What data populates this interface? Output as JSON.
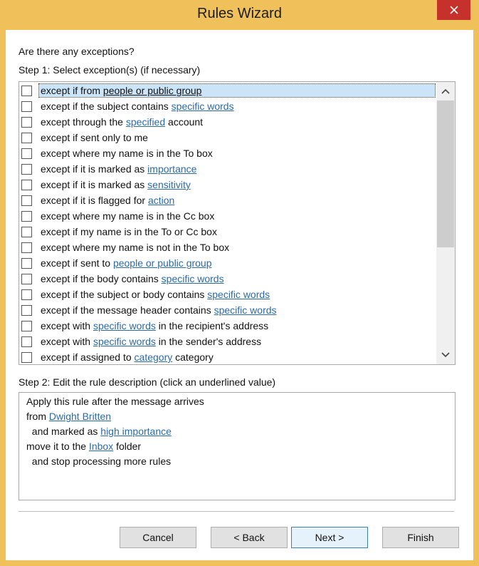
{
  "window": {
    "title": "Rules Wizard"
  },
  "question": "Are there any exceptions?",
  "step1_label": "Step 1: Select exception(s) (if necessary)",
  "step2_label": "Step 2: Edit the rule description (click an underlined value)",
  "exceptions": [
    {
      "pre": "except if from ",
      "link": "people or public group",
      "post": "",
      "selected": true
    },
    {
      "pre": "except if the subject contains ",
      "link": "specific words",
      "post": ""
    },
    {
      "pre": "except through the ",
      "link": "specified",
      "post": " account"
    },
    {
      "pre": "except if sent only to me",
      "link": "",
      "post": ""
    },
    {
      "pre": "except where my name is in the To box",
      "link": "",
      "post": ""
    },
    {
      "pre": "except if it is marked as ",
      "link": "importance",
      "post": ""
    },
    {
      "pre": "except if it is marked as ",
      "link": "sensitivity",
      "post": ""
    },
    {
      "pre": "except if it is flagged for ",
      "link": "action",
      "post": ""
    },
    {
      "pre": "except where my name is in the Cc box",
      "link": "",
      "post": ""
    },
    {
      "pre": "except if my name is in the To or Cc box",
      "link": "",
      "post": ""
    },
    {
      "pre": "except where my name is not in the To box",
      "link": "",
      "post": ""
    },
    {
      "pre": "except if sent to ",
      "link": "people or public group",
      "post": ""
    },
    {
      "pre": "except if the body contains ",
      "link": "specific words",
      "post": ""
    },
    {
      "pre": "except if the subject or body contains ",
      "link": "specific words",
      "post": ""
    },
    {
      "pre": "except if the message header contains ",
      "link": "specific words",
      "post": ""
    },
    {
      "pre": "except with ",
      "link": "specific words",
      "post": " in the recipient's address"
    },
    {
      "pre": "except with ",
      "link": "specific words",
      "post": " in the sender's address"
    },
    {
      "pre": "except if assigned to ",
      "link": "category",
      "post": " category"
    }
  ],
  "description": [
    {
      "pre": "Apply this rule after the message arrives",
      "link": "",
      "post": ""
    },
    {
      "pre": "from ",
      "link": "Dwight Britten",
      "post": ""
    },
    {
      "pre": "  and marked as ",
      "link": "high importance",
      "post": ""
    },
    {
      "pre": "move it to the ",
      "link": "Inbox",
      "post": " folder"
    },
    {
      "pre": "  and stop processing more rules",
      "link": "",
      "post": ""
    }
  ],
  "buttons": {
    "cancel": "Cancel",
    "back": "< Back",
    "next": "Next >",
    "finish": "Finish"
  },
  "colors": {
    "accent": "#f0c05a",
    "close": "#c7312b",
    "link": "#2b6aa8",
    "selection": "#cce4f7"
  }
}
